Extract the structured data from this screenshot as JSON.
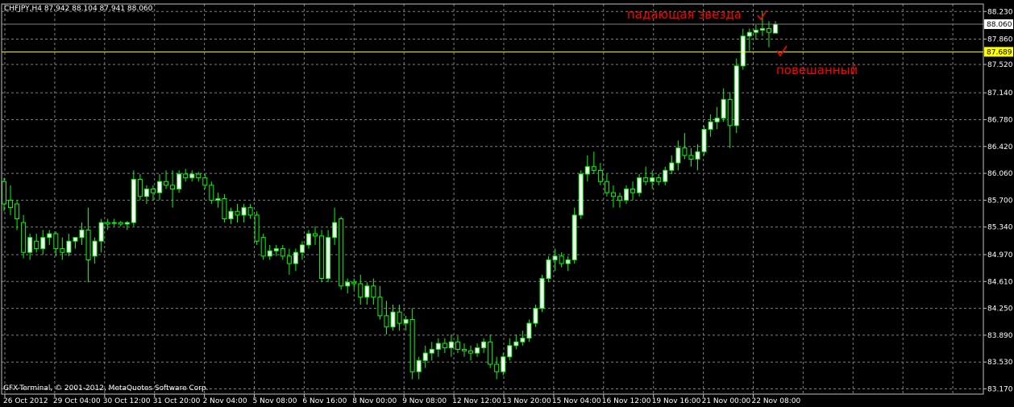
{
  "header": {
    "symbol_info": "CHFJPY,H4  87.942 88.104 87.941 88.060"
  },
  "copyright": "GFX-Terminal, © 2001-2012, MetaQuotes Software Corp.",
  "colors": {
    "background": "#000000",
    "grid": "#808080",
    "bull": "#ffffff",
    "bear": "#000000",
    "wick": "#00ff00",
    "bid_line": "#808080",
    "level_line": "#ffff00",
    "annotation": "#ff0000"
  },
  "chart_data": {
    "type": "candlestick",
    "symbol": "CHFJPY",
    "timeframe": "H4",
    "ylim": [
      83.1,
      88.33
    ],
    "yticks": [
      "88.230",
      "87.860",
      "87.520",
      "87.140",
      "86.780",
      "86.420",
      "86.060",
      "85.700",
      "85.340",
      "84.970",
      "84.610",
      "84.250",
      "83.890",
      "83.530",
      "83.170"
    ],
    "xticks": [
      "26 Oct 2012",
      "29 Oct 04:00",
      "30 Oct 12:00",
      "31 Oct 20:00",
      "2 Nov 04:00",
      "5 Nov 08:00",
      "6 Nov 16:00",
      "8 Nov 00:00",
      "9 Nov 08:00",
      "12 Nov 12:00",
      "13 Nov 20:00",
      "15 Nov 04:00",
      "16 Nov 12:00",
      "19 Nov 16:00",
      "21 Nov 00:00",
      "22 Nov 08:00"
    ],
    "bid_price": 88.06,
    "bid_label": "88.060",
    "level_price": 87.689,
    "level_label": "87.689",
    "grid": true,
    "candles": [
      {
        "o": 85.95,
        "h": 86.0,
        "l": 85.55,
        "c": 85.65
      },
      {
        "o": 85.7,
        "h": 85.9,
        "l": 85.5,
        "c": 85.6
      },
      {
        "o": 85.65,
        "h": 85.7,
        "l": 85.3,
        "c": 85.45
      },
      {
        "o": 85.4,
        "h": 85.5,
        "l": 84.92,
        "c": 85.0
      },
      {
        "o": 85.0,
        "h": 85.25,
        "l": 84.9,
        "c": 85.2
      },
      {
        "o": 85.15,
        "h": 85.25,
        "l": 85.0,
        "c": 85.05
      },
      {
        "o": 85.05,
        "h": 85.3,
        "l": 84.97,
        "c": 85.2
      },
      {
        "o": 85.2,
        "h": 85.3,
        "l": 85.1,
        "c": 85.25
      },
      {
        "o": 85.25,
        "h": 85.28,
        "l": 84.95,
        "c": 85.05
      },
      {
        "o": 85.05,
        "h": 85.2,
        "l": 84.9,
        "c": 85.0
      },
      {
        "o": 85.0,
        "h": 85.25,
        "l": 84.95,
        "c": 85.15
      },
      {
        "o": 85.15,
        "h": 85.2,
        "l": 85.05,
        "c": 85.2
      },
      {
        "o": 85.2,
        "h": 85.4,
        "l": 85.1,
        "c": 85.3
      },
      {
        "o": 85.3,
        "h": 85.6,
        "l": 84.6,
        "c": 84.9
      },
      {
        "o": 84.95,
        "h": 85.2,
        "l": 84.85,
        "c": 85.15
      },
      {
        "o": 85.15,
        "h": 85.45,
        "l": 85.0,
        "c": 85.4
      },
      {
        "o": 85.4,
        "h": 85.45,
        "l": 85.3,
        "c": 85.38
      },
      {
        "o": 85.4,
        "h": 85.45,
        "l": 85.35,
        "c": 85.4
      },
      {
        "o": 85.4,
        "h": 85.42,
        "l": 85.35,
        "c": 85.38
      },
      {
        "o": 85.38,
        "h": 85.42,
        "l": 85.3,
        "c": 85.4
      },
      {
        "o": 85.4,
        "h": 86.1,
        "l": 85.35,
        "c": 85.98
      },
      {
        "o": 85.98,
        "h": 86.05,
        "l": 85.7,
        "c": 85.75
      },
      {
        "o": 85.75,
        "h": 85.9,
        "l": 85.65,
        "c": 85.85
      },
      {
        "o": 85.85,
        "h": 85.9,
        "l": 85.7,
        "c": 85.8
      },
      {
        "o": 85.8,
        "h": 86.05,
        "l": 85.7,
        "c": 85.95
      },
      {
        "o": 85.95,
        "h": 86.1,
        "l": 85.85,
        "c": 85.9
      },
      {
        "o": 85.9,
        "h": 86.1,
        "l": 85.6,
        "c": 85.85
      },
      {
        "o": 85.85,
        "h": 86.1,
        "l": 85.8,
        "c": 86.05
      },
      {
        "o": 86.05,
        "h": 86.12,
        "l": 85.95,
        "c": 86.0
      },
      {
        "o": 86.0,
        "h": 86.1,
        "l": 85.95,
        "c": 86.05
      },
      {
        "o": 86.05,
        "h": 86.08,
        "l": 85.95,
        "c": 86.0
      },
      {
        "o": 86.0,
        "h": 86.05,
        "l": 85.85,
        "c": 85.9
      },
      {
        "o": 85.9,
        "h": 85.95,
        "l": 85.65,
        "c": 85.7
      },
      {
        "o": 85.7,
        "h": 85.8,
        "l": 85.6,
        "c": 85.72
      },
      {
        "o": 85.72,
        "h": 85.78,
        "l": 85.4,
        "c": 85.45
      },
      {
        "o": 85.45,
        "h": 85.6,
        "l": 85.38,
        "c": 85.55
      },
      {
        "o": 85.55,
        "h": 85.65,
        "l": 85.4,
        "c": 85.5
      },
      {
        "o": 85.5,
        "h": 85.65,
        "l": 85.4,
        "c": 85.6
      },
      {
        "o": 85.6,
        "h": 85.65,
        "l": 85.45,
        "c": 85.5
      },
      {
        "o": 85.5,
        "h": 85.55,
        "l": 85.1,
        "c": 85.15
      },
      {
        "o": 85.2,
        "h": 85.25,
        "l": 84.9,
        "c": 84.95
      },
      {
        "o": 84.95,
        "h": 85.1,
        "l": 84.9,
        "c": 85.02
      },
      {
        "o": 85.02,
        "h": 85.1,
        "l": 84.95,
        "c": 85.05
      },
      {
        "o": 85.05,
        "h": 85.1,
        "l": 84.9,
        "c": 84.95
      },
      {
        "o": 84.95,
        "h": 85.05,
        "l": 84.7,
        "c": 84.85
      },
      {
        "o": 84.85,
        "h": 85.05,
        "l": 84.75,
        "c": 85.0
      },
      {
        "o": 85.0,
        "h": 85.15,
        "l": 84.9,
        "c": 85.1
      },
      {
        "o": 85.1,
        "h": 85.3,
        "l": 85.05,
        "c": 85.25
      },
      {
        "o": 85.25,
        "h": 85.35,
        "l": 85.1,
        "c": 85.22
      },
      {
        "o": 85.22,
        "h": 85.3,
        "l": 84.6,
        "c": 84.65
      },
      {
        "o": 84.65,
        "h": 85.3,
        "l": 84.6,
        "c": 85.2
      },
      {
        "o": 85.2,
        "h": 85.6,
        "l": 85.1,
        "c": 85.4
      },
      {
        "o": 85.45,
        "h": 85.48,
        "l": 84.5,
        "c": 84.55
      },
      {
        "o": 84.55,
        "h": 84.65,
        "l": 84.45,
        "c": 84.6
      },
      {
        "o": 84.6,
        "h": 84.65,
        "l": 84.5,
        "c": 84.58
      },
      {
        "o": 84.58,
        "h": 84.7,
        "l": 84.3,
        "c": 84.4
      },
      {
        "o": 84.4,
        "h": 84.6,
        "l": 84.3,
        "c": 84.55
      },
      {
        "o": 84.55,
        "h": 84.65,
        "l": 84.3,
        "c": 84.4
      },
      {
        "o": 84.4,
        "h": 84.55,
        "l": 84.1,
        "c": 84.15
      },
      {
        "o": 84.15,
        "h": 84.35,
        "l": 83.9,
        "c": 84.0
      },
      {
        "o": 84.0,
        "h": 84.3,
        "l": 83.95,
        "c": 84.2
      },
      {
        "o": 84.2,
        "h": 84.3,
        "l": 83.95,
        "c": 84.05
      },
      {
        "o": 84.05,
        "h": 84.15,
        "l": 83.95,
        "c": 84.1
      },
      {
        "o": 84.1,
        "h": 84.25,
        "l": 83.3,
        "c": 83.4
      },
      {
        "o": 83.4,
        "h": 83.6,
        "l": 83.3,
        "c": 83.55
      },
      {
        "o": 83.55,
        "h": 83.75,
        "l": 83.45,
        "c": 83.65
      },
      {
        "o": 83.65,
        "h": 83.8,
        "l": 83.55,
        "c": 83.7
      },
      {
        "o": 83.7,
        "h": 83.85,
        "l": 83.6,
        "c": 83.78
      },
      {
        "o": 83.78,
        "h": 83.85,
        "l": 83.65,
        "c": 83.72
      },
      {
        "o": 83.72,
        "h": 83.9,
        "l": 83.6,
        "c": 83.8
      },
      {
        "o": 83.8,
        "h": 83.88,
        "l": 83.65,
        "c": 83.7
      },
      {
        "o": 83.7,
        "h": 83.78,
        "l": 83.6,
        "c": 83.68
      },
      {
        "o": 83.68,
        "h": 83.75,
        "l": 83.55,
        "c": 83.65
      },
      {
        "o": 83.65,
        "h": 83.78,
        "l": 83.6,
        "c": 83.72
      },
      {
        "o": 83.72,
        "h": 83.85,
        "l": 83.65,
        "c": 83.8
      },
      {
        "o": 83.8,
        "h": 83.9,
        "l": 83.45,
        "c": 83.5
      },
      {
        "o": 83.5,
        "h": 83.6,
        "l": 83.3,
        "c": 83.4
      },
      {
        "o": 83.4,
        "h": 83.65,
        "l": 83.35,
        "c": 83.6
      },
      {
        "o": 83.6,
        "h": 83.85,
        "l": 83.55,
        "c": 83.75
      },
      {
        "o": 83.75,
        "h": 83.9,
        "l": 83.7,
        "c": 83.8
      },
      {
        "o": 83.8,
        "h": 83.95,
        "l": 83.75,
        "c": 83.85
      },
      {
        "o": 83.85,
        "h": 84.1,
        "l": 83.8,
        "c": 84.05
      },
      {
        "o": 84.05,
        "h": 84.3,
        "l": 84.0,
        "c": 84.25
      },
      {
        "o": 84.25,
        "h": 84.7,
        "l": 84.2,
        "c": 84.65
      },
      {
        "o": 84.65,
        "h": 84.95,
        "l": 84.6,
        "c": 84.9
      },
      {
        "o": 84.9,
        "h": 85.05,
        "l": 84.75,
        "c": 84.95
      },
      {
        "o": 84.95,
        "h": 85.0,
        "l": 84.8,
        "c": 84.85
      },
      {
        "o": 84.85,
        "h": 84.95,
        "l": 84.75,
        "c": 84.9
      },
      {
        "o": 84.9,
        "h": 85.6,
        "l": 84.85,
        "c": 85.5
      },
      {
        "o": 85.5,
        "h": 86.1,
        "l": 85.45,
        "c": 86.05
      },
      {
        "o": 86.05,
        "h": 86.3,
        "l": 85.95,
        "c": 86.15
      },
      {
        "o": 86.15,
        "h": 86.35,
        "l": 86.05,
        "c": 86.1
      },
      {
        "o": 86.1,
        "h": 86.2,
        "l": 85.9,
        "c": 85.95
      },
      {
        "o": 85.95,
        "h": 86.05,
        "l": 85.75,
        "c": 85.8
      },
      {
        "o": 85.8,
        "h": 85.9,
        "l": 85.6,
        "c": 85.75
      },
      {
        "o": 85.75,
        "h": 85.8,
        "l": 85.6,
        "c": 85.7
      },
      {
        "o": 85.7,
        "h": 85.9,
        "l": 85.65,
        "c": 85.85
      },
      {
        "o": 85.85,
        "h": 85.95,
        "l": 85.7,
        "c": 85.8
      },
      {
        "o": 85.8,
        "h": 86.05,
        "l": 85.75,
        "c": 86.0
      },
      {
        "o": 86.0,
        "h": 86.15,
        "l": 85.9,
        "c": 85.95
      },
      {
        "o": 85.95,
        "h": 86.1,
        "l": 85.85,
        "c": 86.0
      },
      {
        "o": 86.0,
        "h": 86.05,
        "l": 85.9,
        "c": 85.95
      },
      {
        "o": 85.95,
        "h": 86.15,
        "l": 85.9,
        "c": 86.1
      },
      {
        "o": 86.1,
        "h": 86.3,
        "l": 86.05,
        "c": 86.2
      },
      {
        "o": 86.2,
        "h": 86.5,
        "l": 86.1,
        "c": 86.4
      },
      {
        "o": 86.4,
        "h": 86.6,
        "l": 86.25,
        "c": 86.3
      },
      {
        "o": 86.3,
        "h": 86.4,
        "l": 86.15,
        "c": 86.25
      },
      {
        "o": 86.25,
        "h": 86.45,
        "l": 86.1,
        "c": 86.35
      },
      {
        "o": 86.35,
        "h": 86.7,
        "l": 86.3,
        "c": 86.65
      },
      {
        "o": 86.65,
        "h": 86.85,
        "l": 86.55,
        "c": 86.75
      },
      {
        "o": 86.75,
        "h": 86.95,
        "l": 86.65,
        "c": 86.8
      },
      {
        "o": 86.8,
        "h": 87.2,
        "l": 86.75,
        "c": 87.05
      },
      {
        "o": 87.05,
        "h": 87.15,
        "l": 86.4,
        "c": 86.7
      },
      {
        "o": 86.7,
        "h": 87.6,
        "l": 86.6,
        "c": 87.5
      },
      {
        "o": 87.5,
        "h": 88.0,
        "l": 87.45,
        "c": 87.9
      },
      {
        "o": 87.9,
        "h": 88.0,
        "l": 87.7,
        "c": 87.95
      },
      {
        "o": 87.95,
        "h": 88.05,
        "l": 87.85,
        "c": 87.98
      },
      {
        "o": 87.98,
        "h": 88.22,
        "l": 87.9,
        "c": 88.0
      },
      {
        "o": 88.0,
        "h": 88.1,
        "l": 87.75,
        "c": 87.95
      },
      {
        "o": 87.94,
        "h": 88.1,
        "l": 87.94,
        "c": 88.06
      }
    ],
    "annotations": [
      {
        "text": "падающая звезда",
        "price": 88.2
      },
      {
        "text": "повешанный",
        "price": 87.52
      }
    ]
  }
}
